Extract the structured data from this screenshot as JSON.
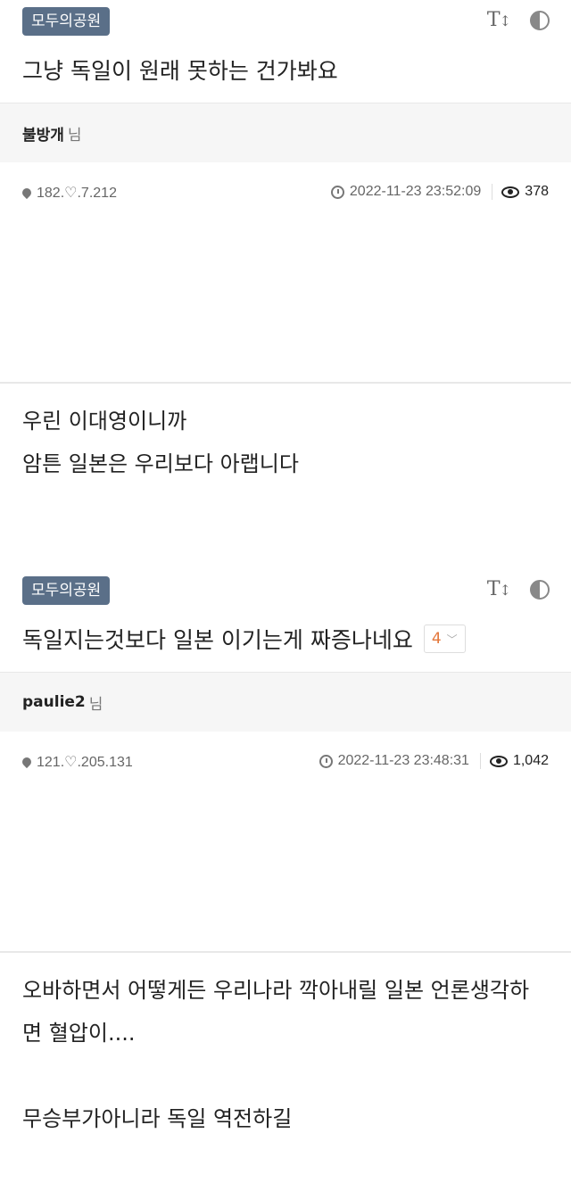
{
  "posts": [
    {
      "board": "모두의공원",
      "title": "그냥 독일이 원래 못하는 건가봐요",
      "comment_count": "",
      "author": "불방개",
      "author_suffix": "님",
      "ip": "182.♡.7.212",
      "datetime": "2022-11-23 23:52:09",
      "views": "378",
      "body": [
        "우린 이대영이니까",
        "암튼 일본은 우리보다 아랩니다"
      ]
    },
    {
      "board": "모두의공원",
      "title": "독일지는것보다 일본 이기는게 짜증나네요",
      "comment_count": "4",
      "author": "paulie2",
      "author_suffix": "님",
      "ip": "121.♡.205.131",
      "datetime": "2022-11-23 23:48:31",
      "views": "1,042",
      "body": [
        "오바하면서 어떻게든 우리나라 깍아내릴 일본 언론생각하",
        "면 혈압이....",
        "",
        "무승부가아니라 독일 역전하길"
      ]
    }
  ],
  "tools": {
    "font_size_icon": "T↕",
    "contrast_icon": "contrast-icon"
  }
}
